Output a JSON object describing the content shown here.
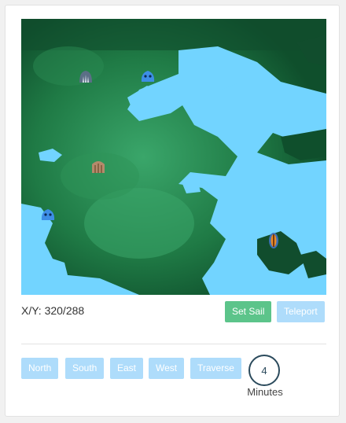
{
  "map": {
    "markers": [
      {
        "name": "cave-icon",
        "color": "#5b6f86"
      },
      {
        "name": "blue-slime-icon",
        "color": "#3d8ee6"
      },
      {
        "name": "wooden-gate-icon",
        "color": "#b48a6b"
      },
      {
        "name": "blue-slime-icon",
        "color": "#3d8ee6"
      },
      {
        "name": "player-ship-icon",
        "color": "#e98b2a"
      }
    ]
  },
  "status": {
    "coords_label": "X/Y: 320/288"
  },
  "actions": {
    "set_sail": "Set Sail",
    "teleport": "Teleport"
  },
  "directions": {
    "north": "North",
    "south": "South",
    "east": "East",
    "west": "West",
    "traverse": "Traverse"
  },
  "timer": {
    "value": "4",
    "unit": "Minutes"
  },
  "colors": {
    "land_dark": "#0e4a2a",
    "land_light": "#3aa66a",
    "water": "#72d4ff",
    "set_sail_button": "#5cc48a",
    "travel_button": "#aedcfb"
  }
}
